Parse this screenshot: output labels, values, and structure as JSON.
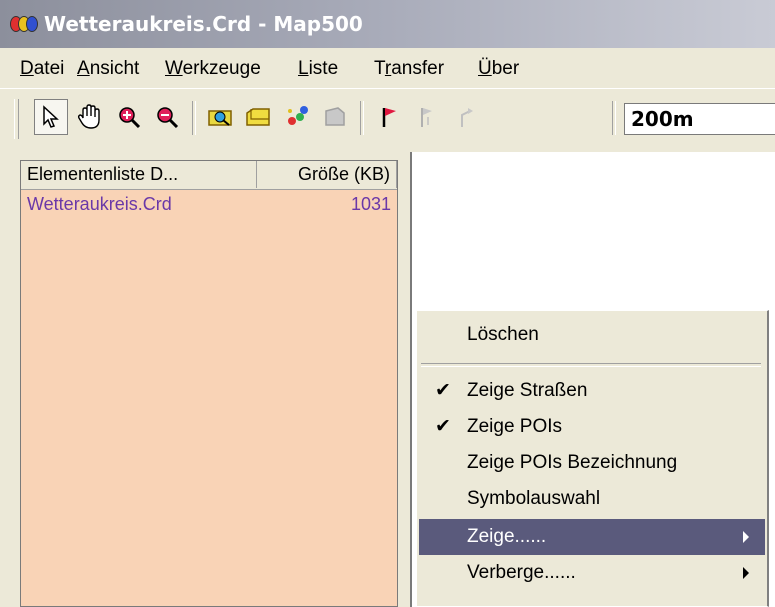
{
  "window": {
    "title": "Wetteraukreis.Crd - Map500"
  },
  "menubar": {
    "items": [
      {
        "label": "Datei",
        "underline": "D",
        "rest": "atei"
      },
      {
        "label": "Ansicht",
        "underline": "A",
        "rest": "nsicht"
      },
      {
        "label": "Werkzeuge",
        "underline": "W",
        "rest": "erkzeuge"
      },
      {
        "label": "Liste",
        "underline": "L",
        "rest": "iste"
      },
      {
        "label": "Transfer",
        "pre": "T",
        "underline": "r",
        "rest": "ansfer"
      },
      {
        "label": "Über",
        "underline": "Ü",
        "rest": "ber"
      }
    ]
  },
  "toolbar": {
    "scale_value": "200m",
    "icons": [
      "pointer-icon",
      "hand-icon",
      "zoom-in-icon",
      "zoom-out-icon",
      "open-map-icon",
      "open-folder-icon",
      "colors-icon",
      "disabled-card-icon",
      "flag-icon",
      "flag-disabled-icon",
      "route-disabled-icon"
    ]
  },
  "list": {
    "columns": [
      "Elementenliste D...",
      "Größe (KB)"
    ],
    "rows": [
      {
        "name": "Wetteraukreis.Crd",
        "size": "1031"
      }
    ]
  },
  "context_menu": {
    "items": [
      {
        "label": "Löschen",
        "checked": false,
        "submenu": false
      },
      {
        "label": "Zeige Straßen",
        "checked": true,
        "submenu": false
      },
      {
        "label": "Zeige POIs",
        "checked": true,
        "submenu": false
      },
      {
        "label": "Zeige POIs Bezeichnung",
        "checked": false,
        "submenu": false
      },
      {
        "label": "Symbolauswahl",
        "checked": false,
        "submenu": false
      },
      {
        "label": "Zeige......",
        "checked": false,
        "submenu": true,
        "selected": true
      },
      {
        "label": "Verberge......",
        "checked": false,
        "submenu": true
      }
    ],
    "check_glyph": "✔"
  },
  "colors": {
    "list_bg": "#f9d3b6",
    "list_text": "#6a38a8",
    "menu_highlight": "#5a5a7c"
  }
}
